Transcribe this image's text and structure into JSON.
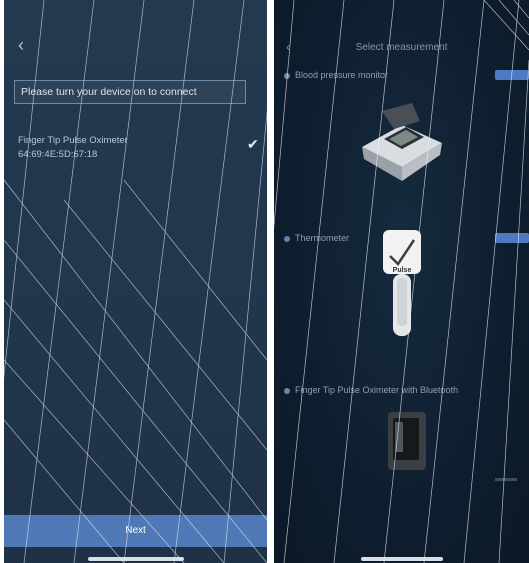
{
  "left_screen": {
    "back_glyph": "‹",
    "prompt": "Please turn your device on to connect",
    "device_name": "Finger Tip Pulse Oximeter",
    "device_id": "64:69:4E:5D:67:18",
    "check_glyph": "✔",
    "next_label": "Next"
  },
  "right_screen": {
    "title": "Select measurement",
    "step1": "Blood pressure monitor",
    "step2": "Thermometer",
    "step3": "Finger Tip Pulse Oximeter with Bluetooth",
    "thermo_badge": "Pulse",
    "accent_color": "#4e79c3"
  }
}
